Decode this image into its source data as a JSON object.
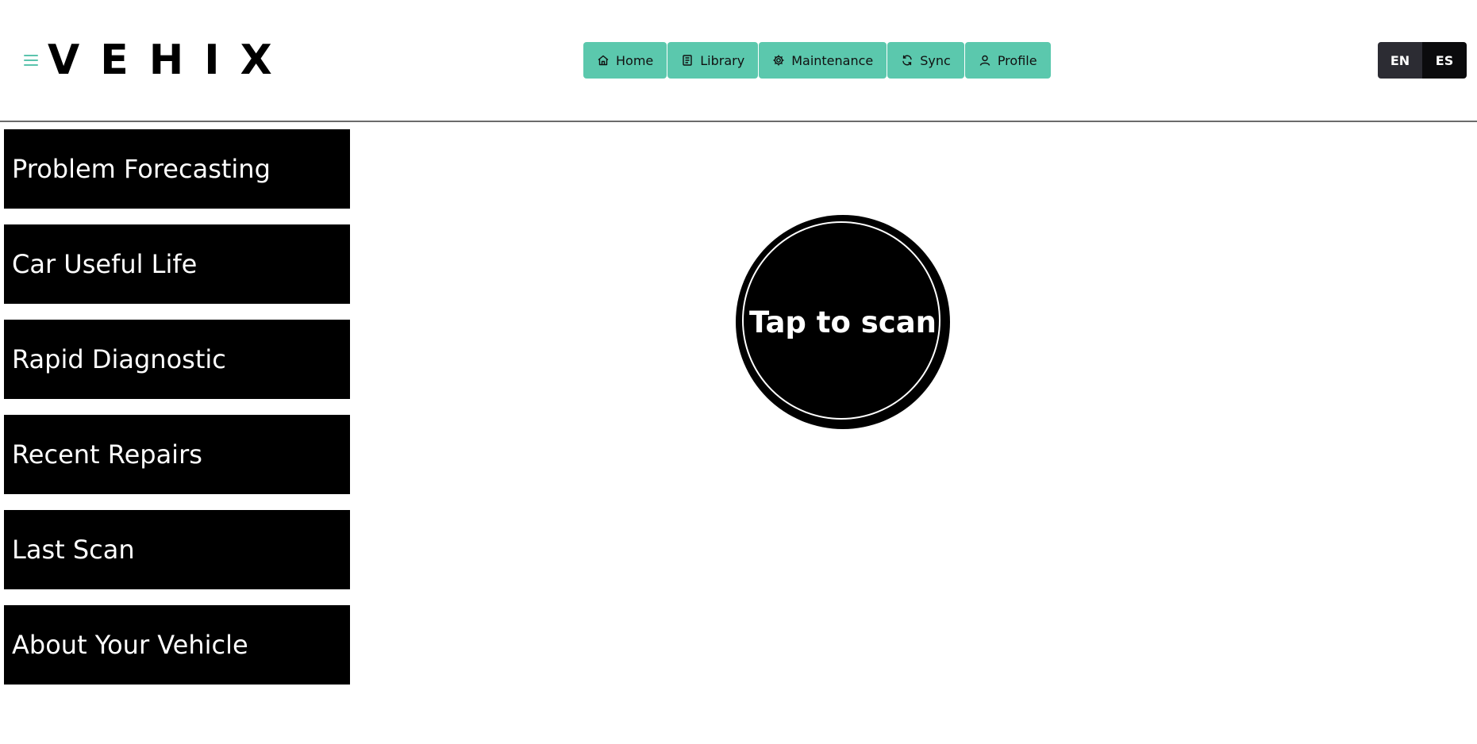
{
  "brand": {
    "logo_text": "VEHIX",
    "accent_color": "#5bc8ad"
  },
  "header": {
    "menu_icon": "hamburger-icon",
    "nav": [
      {
        "label": "Home",
        "icon": "home-icon"
      },
      {
        "label": "Library",
        "icon": "book-icon"
      },
      {
        "label": "Maintenance",
        "icon": "gear-icon"
      },
      {
        "label": "Sync",
        "icon": "sync-icon"
      },
      {
        "label": "Profile",
        "icon": "user-icon"
      }
    ],
    "languages": [
      "EN",
      "ES"
    ]
  },
  "sidebar": {
    "items": [
      {
        "label": "Problem Forecasting"
      },
      {
        "label": "Car Useful Life"
      },
      {
        "label": "Rapid Diagnostic"
      },
      {
        "label": "Recent Repairs"
      },
      {
        "label": "Last Scan"
      },
      {
        "label": "About Your Vehicle"
      }
    ]
  },
  "main": {
    "scan_button_label": "Tap to scan"
  }
}
